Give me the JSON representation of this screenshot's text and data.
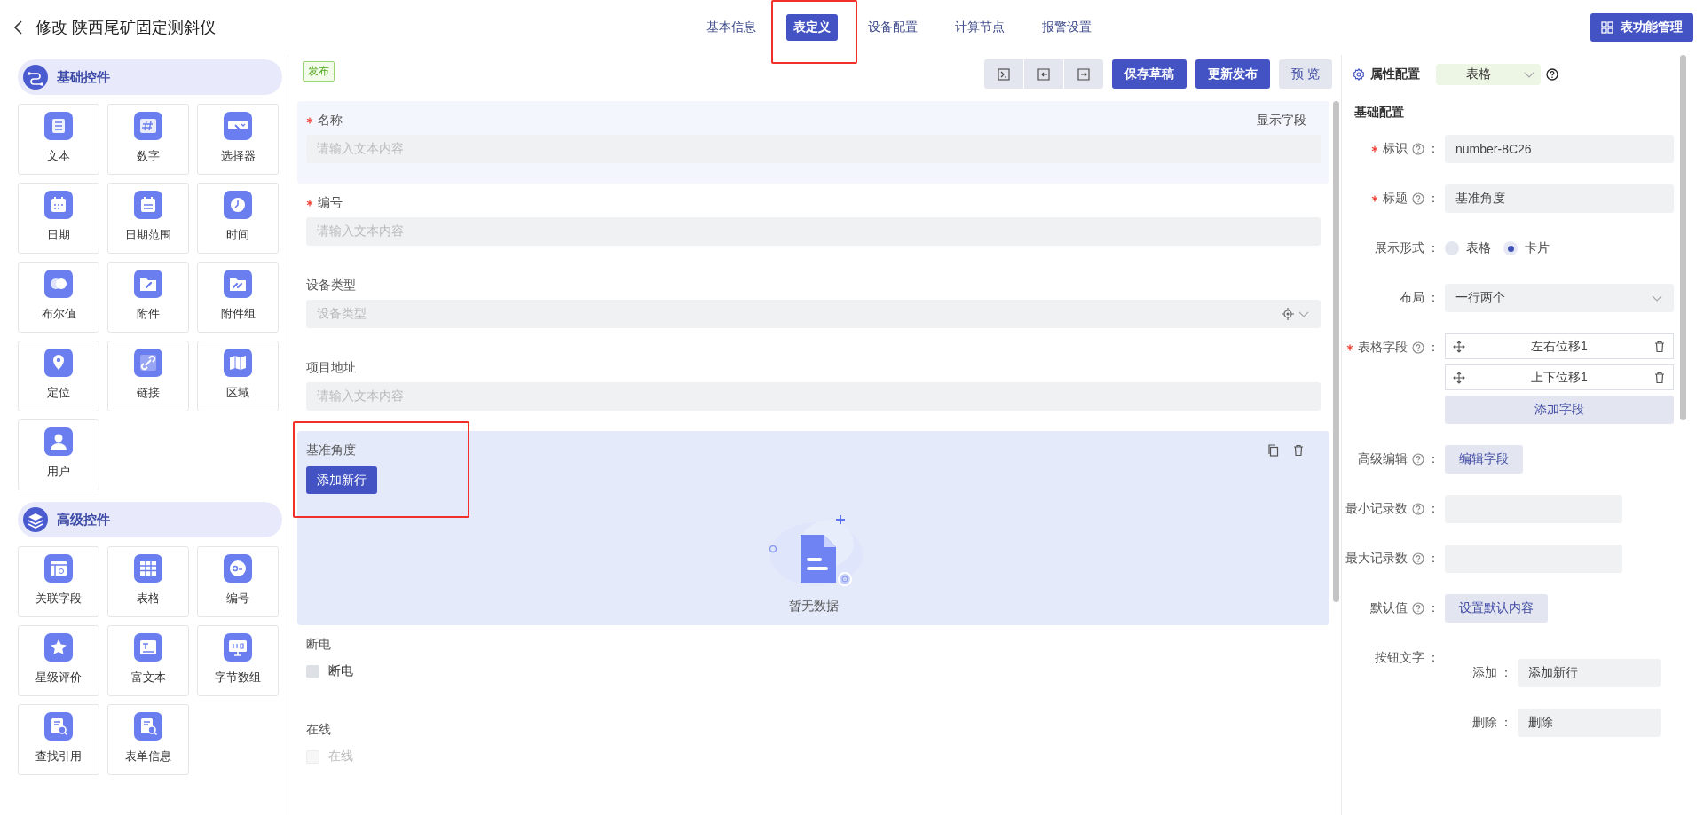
{
  "header": {
    "title": "修改 陕西尾矿固定测斜仪",
    "tabs": [
      {
        "label": "基本信息",
        "selected": false
      },
      {
        "label": "表定义",
        "selected": true
      },
      {
        "label": "设备配置",
        "selected": false
      },
      {
        "label": "计算节点",
        "selected": false
      },
      {
        "label": "报警设置",
        "selected": false
      }
    ],
    "manage_button": "表功能管理"
  },
  "palette": {
    "sections": [
      {
        "title": "基础控件",
        "items": [
          "文本",
          "数字",
          "选择器",
          "日期",
          "日期范围",
          "时间",
          "布尔值",
          "附件",
          "附件组",
          "定位",
          "链接",
          "区域",
          "用户"
        ]
      },
      {
        "title": "高级控件",
        "items": [
          "关联字段",
          "表格",
          "编号",
          "星级评价",
          "富文本",
          "字节数组",
          "查找引用",
          "表单信息"
        ]
      }
    ]
  },
  "toolbar": {
    "status_tag": "发布",
    "buttons": [
      {
        "label": "保存草稿",
        "kind": "primary"
      },
      {
        "label": "更新发布",
        "kind": "primary"
      },
      {
        "label": "预 览",
        "kind": "plain"
      }
    ]
  },
  "form": {
    "fields": [
      {
        "kind": "text",
        "label": "名称",
        "required": true,
        "placeholder": "请输入文本内容",
        "side_link": "显示字段",
        "hovered": true,
        "selected": false
      },
      {
        "kind": "text",
        "label": "编号",
        "required": true,
        "placeholder": "请输入文本内容",
        "hovered": false,
        "selected": false
      },
      {
        "kind": "select",
        "label": "设备类型",
        "required": false,
        "placeholder": "设备类型",
        "hovered": false,
        "selected": false
      },
      {
        "kind": "text",
        "label": "项目地址",
        "required": false,
        "placeholder": "请输入文本内容",
        "hovered": false,
        "selected": false
      },
      {
        "kind": "table",
        "label": "基准角度",
        "required": false,
        "add_button": "添加新行",
        "empty_text": "暂无数据",
        "hovered": false,
        "selected": true
      },
      {
        "kind": "checkbox",
        "label": "断电",
        "required": false,
        "option": "断电",
        "checked": false,
        "disabled": false,
        "hovered": false,
        "selected": false
      },
      {
        "kind": "checkbox",
        "label": "在线",
        "required": false,
        "option": "在线",
        "checked": false,
        "disabled": true,
        "hovered": false,
        "selected": false
      }
    ]
  },
  "properties": {
    "title": "属性配置",
    "type_select": "表格",
    "section": "基础配置",
    "rows": [
      {
        "kind": "input",
        "label": "标识",
        "required": true,
        "help": true,
        "colon": "：",
        "value": "number-8C26"
      },
      {
        "kind": "input",
        "label": "标题",
        "required": true,
        "help": true,
        "colon": "：",
        "value": "基准角度"
      },
      {
        "kind": "radio",
        "label": "展示形式",
        "required": false,
        "help": false,
        "colon": "：",
        "options": [
          {
            "label": "表格",
            "selected": false
          },
          {
            "label": "卡片",
            "selected": true
          }
        ]
      },
      {
        "kind": "select",
        "label": "布局",
        "required": false,
        "help": false,
        "colon": "：",
        "value": "一行两个"
      },
      {
        "kind": "field_list",
        "label": "表格字段",
        "required": true,
        "help": true,
        "colon": "：",
        "items": [
          "左右位移1",
          "上下位移1"
        ],
        "button": "添加字段"
      },
      {
        "kind": "button",
        "label": "高级编辑",
        "required": false,
        "help": true,
        "colon": "：",
        "button": "编辑字段"
      },
      {
        "kind": "short_input",
        "label": "最小记录数",
        "required": false,
        "help": true,
        "colon": "："
      },
      {
        "kind": "short_input",
        "label": "最大记录数",
        "required": false,
        "help": true,
        "colon": "："
      },
      {
        "kind": "button",
        "label": "默认值",
        "required": false,
        "help": true,
        "colon": "：",
        "button": "设置默认内容"
      },
      {
        "kind": "button_texts",
        "label": "按钮文字",
        "required": false,
        "help": false,
        "colon": "：",
        "items": [
          {
            "label": "添加",
            "colon": "：",
            "value": "添加新行"
          },
          {
            "label": "删除",
            "colon": "：",
            "value": "删除"
          }
        ]
      }
    ]
  }
}
